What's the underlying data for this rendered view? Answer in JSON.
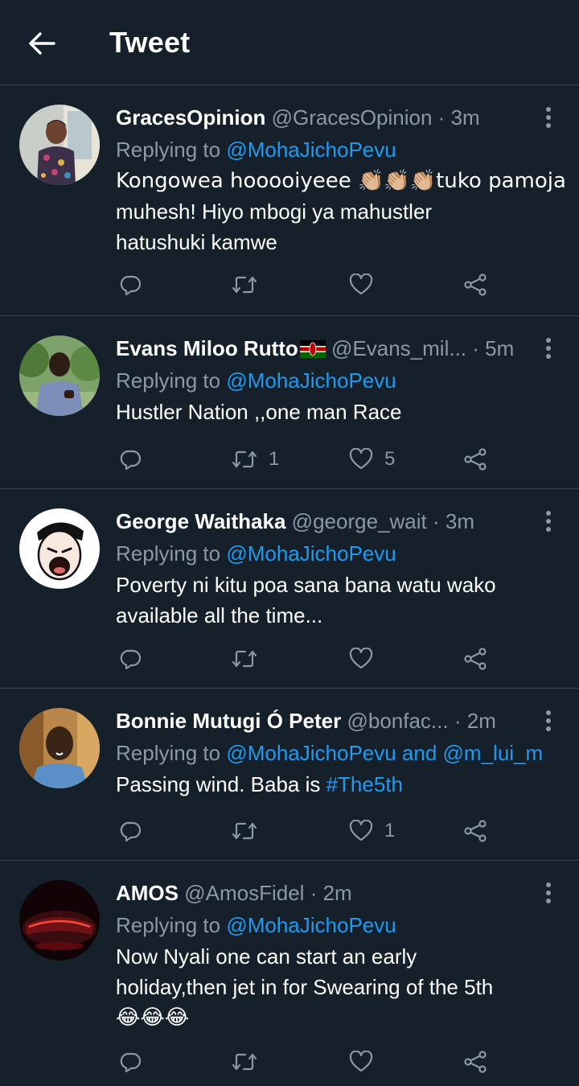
{
  "header": {
    "title": "Tweet",
    "back_icon": "arrow-left-icon"
  },
  "colors": {
    "background": "#15202b",
    "link": "#1d9bf0",
    "muted": "#8b98a5",
    "divider": "#38444d"
  },
  "replies": [
    {
      "name": "GracesOpinion",
      "handle": "@GracesOpinion",
      "time": "3m",
      "replying_prefix": "Replying to ",
      "replying_to": "@MohaJichoPevu",
      "text_lines": [
        "Kongowea hoooоiyeee 👏🏼👏🏼👏🏼tuko pamoja",
        "muhesh! Hiyo mbogi ya mahustler",
        "hatushuki kamwe"
      ],
      "retweets": "",
      "likes": ""
    },
    {
      "name": "Evans Miloo Rutto",
      "name_flag": "kenya-flag-icon",
      "handle": "@Evans_mil...",
      "time": "5m",
      "replying_prefix": "Replying to ",
      "replying_to": "@MohaJichoPevu",
      "text_lines": [
        "Hustler Nation ,,one man Race"
      ],
      "retweets": "1",
      "likes": "5"
    },
    {
      "name": "George Waithaka",
      "handle": "@george_wait",
      "time": "3m",
      "replying_prefix": "Replying to ",
      "replying_to": "@MohaJichoPevu",
      "text_lines": [
        "Poverty ni kitu poa sana bana watu wako",
        "available all the time..."
      ],
      "retweets": "",
      "likes": ""
    },
    {
      "name": "Bonnie Mutugi Ó Peter",
      "handle": "@bonfac...",
      "time": "2m",
      "replying_prefix": "Replying to ",
      "replying_to": "@MohaJichoPevu and @m_lui_m",
      "text_prefix": "Passing wind. Baba is ",
      "text_hashtag": "#The5th",
      "retweets": "",
      "likes": "1"
    },
    {
      "name": "AMOS",
      "handle": "@AmosFidel",
      "time": "2m",
      "replying_prefix": "Replying to ",
      "replying_to": "@MohaJichoPevu",
      "text_lines": [
        "Now Nyali one can start an early",
        "holiday,then jet in for Swearing of the 5th",
        "😂😂😂"
      ],
      "retweets": "",
      "likes": ""
    }
  ],
  "icons": {
    "reply": "reply-icon",
    "retweet": "retweet-icon",
    "like": "heart-icon",
    "share": "share-icon",
    "more": "more-vertical-icon"
  }
}
